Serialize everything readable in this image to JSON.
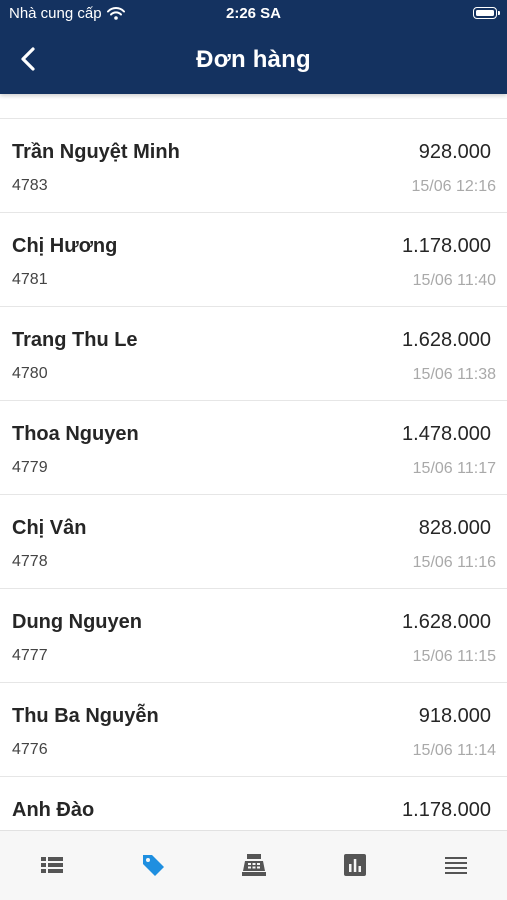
{
  "status_bar": {
    "carrier": "Nhà cung cấp",
    "time": "2:26 SA",
    "icons": [
      "wifi-icon",
      "battery-icon"
    ]
  },
  "nav": {
    "title": "Đơn hàng",
    "back_icon": "chevron-left-icon"
  },
  "orders": [
    {
      "name": "Trần Nguyệt Minh",
      "code": "4783",
      "amount": "928.000",
      "time": "15/06 12:16"
    },
    {
      "name": "Chị Hương",
      "code": "4781",
      "amount": "1.178.000",
      "time": "15/06 11:40"
    },
    {
      "name": "Trang Thu Le",
      "code": "4780",
      "amount": "1.628.000",
      "time": "15/06 11:38"
    },
    {
      "name": "Thoa Nguyen",
      "code": "4779",
      "amount": "1.478.000",
      "time": "15/06 11:17"
    },
    {
      "name": "Chị Vân",
      "code": "4778",
      "amount": "828.000",
      "time": "15/06 11:16"
    },
    {
      "name": "Dung Nguyen",
      "code": "4777",
      "amount": "1.628.000",
      "time": "15/06 11:15"
    },
    {
      "name": "Thu Ba Nguyễn",
      "code": "4776",
      "amount": "918.000",
      "time": "15/06 11:14"
    },
    {
      "name": "Anh Đào",
      "code": "",
      "amount": "1.178.000",
      "time": ""
    }
  ],
  "tabbar": {
    "tabs": [
      {
        "icon": "list-icon",
        "active": false
      },
      {
        "icon": "tag-icon",
        "active": true
      },
      {
        "icon": "cash-register-icon",
        "active": false
      },
      {
        "icon": "bar-chart-icon",
        "active": false
      },
      {
        "icon": "menu-icon",
        "active": false
      }
    ],
    "active_color": "#1f8fe0",
    "inactive_color": "#555555"
  },
  "colors": {
    "header_bg": "#143260",
    "header_text": "#ffffff",
    "timestamp": "#a9a9a9"
  }
}
